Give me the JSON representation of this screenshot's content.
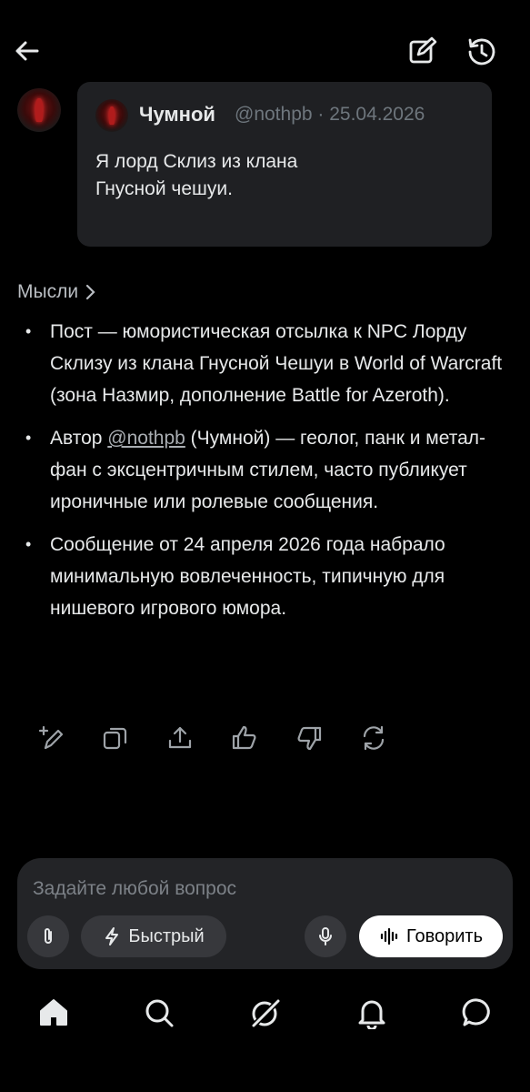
{
  "topbar": {
    "back_icon": "arrow-left-icon",
    "edit_icon": "edit-icon",
    "history_icon": "history-icon"
  },
  "post": {
    "author_name": "Чумной",
    "meta": "@nothpb · 25.04.2026",
    "text": "Я лорд Склиз из клана\nГнусной чешуи."
  },
  "thoughts": {
    "label": "Мысли",
    "bullets": [
      {
        "text": "Пост — юмористическая отсылка к NPC Лорду Склизу из клана Гнусной Чешуи в World of Warcraft (зона Назмир, дополнение Battle for Azeroth)."
      },
      {
        "pre": "Автор ",
        "mention": "@nothpb",
        "post": " (Чумной) — геолог, панк и метал-фан с эксцентричным стилем, часто публикует ироничные или ролевые сообщения."
      },
      {
        "text": "Сообщение от 24 апреля 2026 года набрало минимальную вовлеченность, типичную для нишевого игрового юмора."
      }
    ]
  },
  "actions": [
    "edit-sparkle-icon",
    "copy-icon",
    "share-icon",
    "thumbs-up-icon",
    "thumbs-down-icon",
    "regenerate-icon"
  ],
  "composer": {
    "placeholder": "Задайте любой вопрос",
    "mode_label": "Быстрый",
    "speak_label": "Говорить"
  },
  "nav": [
    "home-icon",
    "search-icon",
    "grok-icon",
    "notifications-icon",
    "messages-icon"
  ]
}
